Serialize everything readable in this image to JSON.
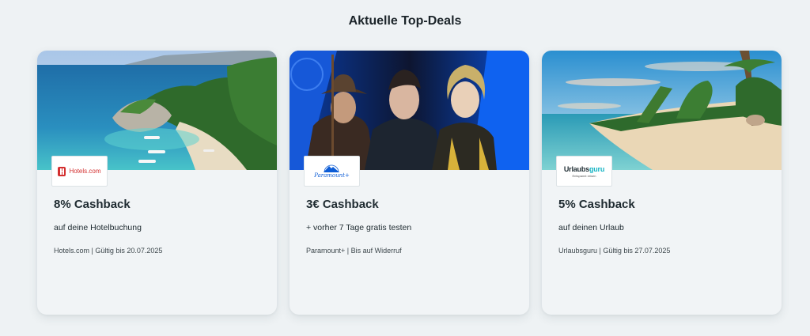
{
  "section": {
    "title": "Aktuelle Top-Deals"
  },
  "deals": [
    {
      "image": "beach-cove-photo",
      "logo_text": "Hotels.com",
      "title": "8% Cashback",
      "description": "auf deine Hotelbuchung",
      "meta": "Hotels.com | Gültig bis 20.07.2025"
    },
    {
      "image": "tv-shows-collage-photo",
      "logo_text": "Paramount+",
      "title": "3€ Cashback",
      "description": "+ vorher 7 Tage gratis testen",
      "meta": "Paramount+ | Bis auf Widerruf"
    },
    {
      "image": "palm-beach-photo",
      "logo_text": "Urlaubsguru",
      "logo_sub": "Entspannt reisen",
      "title": "5% Cashback",
      "description": "auf deinen Urlaub",
      "meta": "Urlaubsguru | Gültig bis 27.07.2025"
    }
  ],
  "colors": {
    "page_bg": "#eef2f4",
    "card_bg": "#f1f4f6",
    "hotels_red": "#d32f2f",
    "paramount_blue": "#0c5cd6",
    "urlaubsguru_teal": "#14b4c4"
  }
}
